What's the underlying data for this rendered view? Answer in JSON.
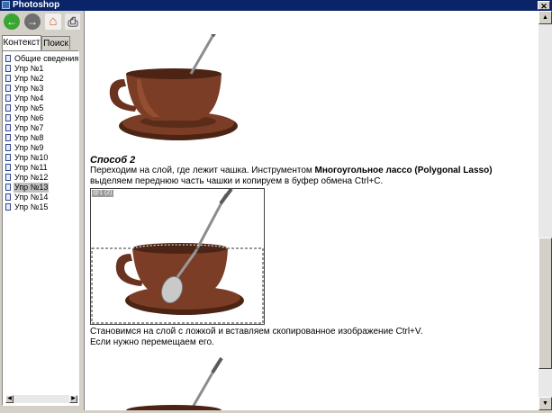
{
  "window": {
    "title": "Photoshop"
  },
  "toolbar": {
    "buttons": [
      {
        "name": "back",
        "glyph": "←",
        "color": "#3aa632"
      },
      {
        "name": "forward",
        "glyph": "→",
        "color": "#6f6f6f"
      },
      {
        "name": "home",
        "glyph": "⌂",
        "color": "#d65c23"
      },
      {
        "name": "print",
        "glyph": "⎙",
        "color": "#7a7a7a"
      }
    ]
  },
  "tabs": [
    {
      "label": "Контекст",
      "active": true
    },
    {
      "label": "Поиск",
      "active": false
    }
  ],
  "tree": {
    "items": [
      {
        "label": "Общие сведения",
        "selected": false
      },
      {
        "label": "Упр №1",
        "selected": false
      },
      {
        "label": "Упр №2",
        "selected": false
      },
      {
        "label": "Упр №3",
        "selected": false
      },
      {
        "label": "Упр №4",
        "selected": false
      },
      {
        "label": "Упр №5",
        "selected": false
      },
      {
        "label": "Упр №6",
        "selected": false
      },
      {
        "label": "Упр №7",
        "selected": false
      },
      {
        "label": "Упр №8",
        "selected": false
      },
      {
        "label": "Упр №9",
        "selected": false
      },
      {
        "label": "Упр №10",
        "selected": false
      },
      {
        "label": "Упр №11",
        "selected": false
      },
      {
        "label": "Упр №12",
        "selected": false
      },
      {
        "label": "Упр №13",
        "selected": true
      },
      {
        "label": "Упр №14",
        "selected": false
      },
      {
        "label": "Упр №15",
        "selected": false
      }
    ]
  },
  "content": {
    "method_heading": "Способ 2",
    "para1_start": "Переходим на слой, где лежит чашка. Инструментом ",
    "para1_bold": "Многоугольное лассо (Polygonal Lasso)",
    "para1_end": " выделяем переднюю часть чашки и копируем в буфер обмена Ctrl+C.",
    "screenshot_label": "@1 (2)",
    "para2_line1": "Становимся на слой с ложкой и вставляем скопированное изображение Ctrl+V.",
    "para2_line2": "Если нужно перемещаем его."
  },
  "colors": {
    "cup": "#7b3d25",
    "cup_dark": "#4d2414",
    "cup_light": "#a4583a",
    "spoon": "#8d8d8d"
  }
}
